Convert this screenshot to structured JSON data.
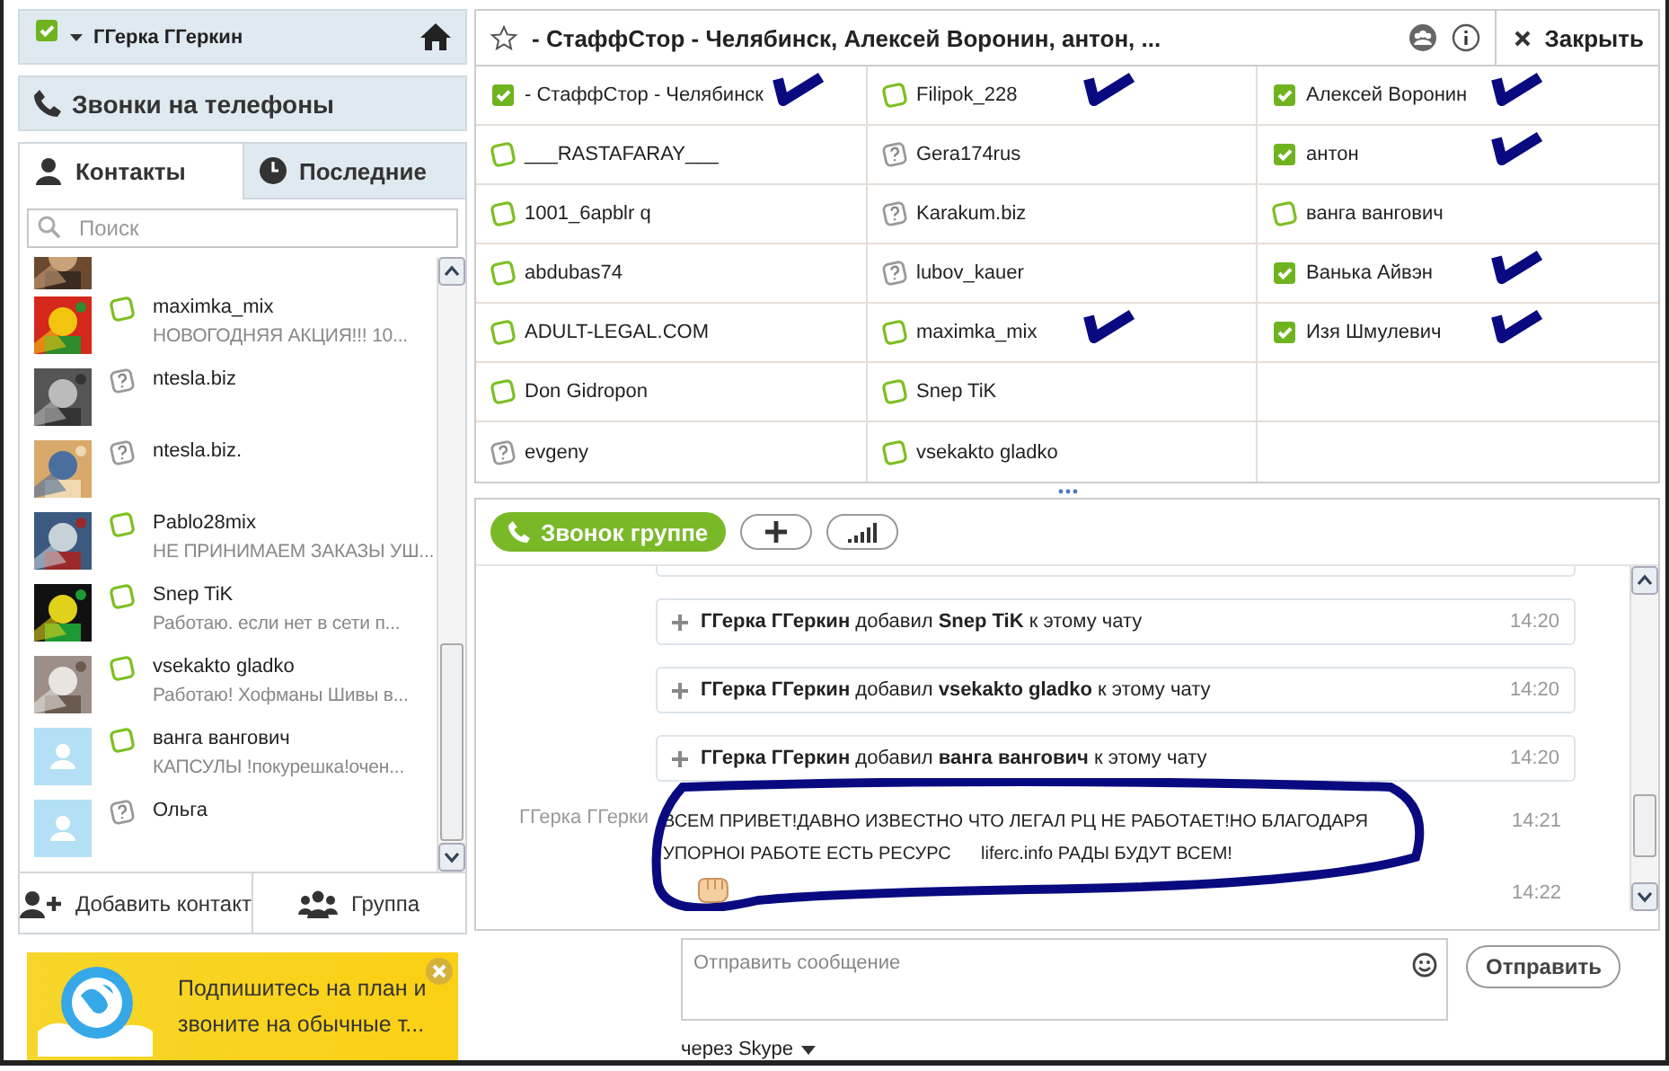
{
  "profile": {
    "name": "ГГерка ГГеркин",
    "online": true
  },
  "calls_button": "Звонки на телефоны",
  "tabs": [
    {
      "label": "Контакты",
      "selected": true
    },
    {
      "label": "Последние",
      "selected": false
    }
  ],
  "search": {
    "placeholder": "Поиск"
  },
  "contacts": [
    {
      "has_photo": true
    },
    {
      "name": "maximka_mix",
      "mood": "НОВОГОДНЯЯ АКЦИЯ!!! 10...",
      "kind": "offline",
      "has_photo": true
    },
    {
      "name": "ntesla.biz",
      "kind": "unknown",
      "has_photo": true
    },
    {
      "name": "ntesla.biz.",
      "kind": "unknown",
      "has_photo": true
    },
    {
      "name": "Pablo28mix",
      "mood": "НЕ ПРИНИМАЕМ ЗАКАЗЫ УШ...",
      "kind": "offline",
      "has_photo": true
    },
    {
      "name": "Snep TiK",
      "mood": "Работаю. если нет в сети п...",
      "kind": "offline",
      "has_photo": true
    },
    {
      "name": "vsekakto gladko",
      "mood": "Работаю! Хофманы Шивы в...",
      "kind": "offline",
      "has_photo": true
    },
    {
      "name": "ванга вангович",
      "mood": "КАПСУЛЫ !покурешка!очен...",
      "kind": "offline",
      "has_photo": false
    },
    {
      "name": "Ольга",
      "kind": "unknown",
      "has_photo": false
    }
  ],
  "sidebar_buttons": [
    "Добавить контакт",
    "Группа"
  ],
  "promo": {
    "text": "Подпишитесь на план и звоните на обычные т..."
  },
  "conversation": {
    "title": "- СтаффСтор -  Челябинск, Алексей Воронин, антон, ...",
    "close": "Закрыть",
    "participants": [
      {
        "name": "- СтаффСтор -  Челябинск",
        "kind": "online",
        "annotated": true
      },
      {
        "name": "___RASTAFARAY___",
        "kind": "offline",
        "annotated": false
      },
      {
        "name": "1001_6apblr q",
        "kind": "offline",
        "annotated": false
      },
      {
        "name": "abdubas74",
        "kind": "offline",
        "annotated": false
      },
      {
        "name": "ADULT-LEGAL.COM",
        "kind": "offline",
        "annotated": false
      },
      {
        "name": "Don Gidropon",
        "kind": "offline",
        "annotated": false
      },
      {
        "name": "evgeny",
        "kind": "unknown",
        "annotated": false
      },
      {
        "name": "Filipok_228",
        "kind": "offline",
        "annotated": true
      },
      {
        "name": "Gera174rus",
        "kind": "unknown",
        "annotated": false
      },
      {
        "name": "Karakum.biz",
        "kind": "unknown",
        "annotated": false
      },
      {
        "name": "lubov_kauer",
        "kind": "unknown",
        "annotated": false
      },
      {
        "name": "maximka_mix",
        "kind": "offline",
        "annotated": true
      },
      {
        "name": "Snep TiK",
        "kind": "offline",
        "annotated": false
      },
      {
        "name": "vsekakto gladko",
        "kind": "offline",
        "annotated": false
      },
      {
        "name": "Алексей Воронин",
        "kind": "online",
        "annotated": true
      },
      {
        "name": "антон",
        "kind": "online",
        "annotated": true
      },
      {
        "name": "ванга вангович",
        "kind": "offline",
        "annotated": false
      },
      {
        "name": "Ванька Айвэн",
        "kind": "online",
        "annotated": true
      },
      {
        "name": "Изя Шмулевич",
        "kind": "online",
        "annotated": true
      }
    ],
    "call_button": "Звонок группе",
    "messages": [
      {
        "kind": "event",
        "text": "**ГГерка ГГеркин** добавил **Snep TiK** к этому чату",
        "time": "14:20"
      },
      {
        "kind": "event",
        "text": "**ГГерка ГГеркин** добавил **vsekakto gladko** к этому чату",
        "time": "14:20"
      },
      {
        "kind": "event",
        "text": "**ГГерка ГГеркин** добавил **ванга вангович** к этому чату",
        "time": "14:20"
      },
      {
        "kind": "text",
        "sender": "ГГерка ГГерки",
        "text": "ВСЕМ ПРИВЕТ!ДАВНО ИЗВЕСТНО ЧТО ЛЕГАЛ РЦ НЕ РАБОТАЕТ!НО БЛАГОДАРЯ\nУПОРНОI РАБОТЕ ЕСТЬ РЕСУРС      liferc.info РАДЫ БУДУТ ВСЕМ!",
        "time": "14:21",
        "circled": true
      },
      {
        "kind": "emoticon",
        "time": "14:22",
        "circled": true
      }
    ],
    "composer": {
      "placeholder": "Отправить сообщение",
      "send": "Отправить",
      "via": "через Skype"
    }
  }
}
